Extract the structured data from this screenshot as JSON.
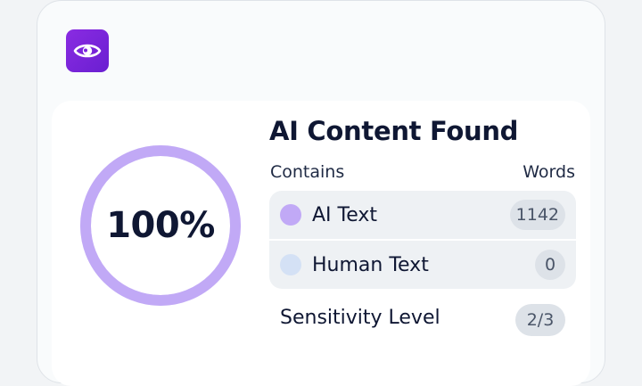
{
  "summary": {
    "title": "AI Content Found",
    "percent_label": "100%",
    "ai_fraction": 1.0,
    "ring_color": "#c1a9f6"
  },
  "table": {
    "header_contains": "Contains",
    "header_words": "Words",
    "rows": [
      {
        "label": "AI Text",
        "count": "1142",
        "dot_color": "#c1a9f6"
      },
      {
        "label": "Human Text",
        "count": "0",
        "dot_color": "#d4e1f5"
      }
    ]
  },
  "sensitivity": {
    "label": "Sensitivity Level",
    "value": "2/3"
  },
  "icons": {
    "app": "eye-icon"
  },
  "colors": {
    "brand": "#7a24dc",
    "panel": "#ffffff",
    "row_bg": "#eef1f4",
    "badge_bg": "#dde2e8"
  }
}
